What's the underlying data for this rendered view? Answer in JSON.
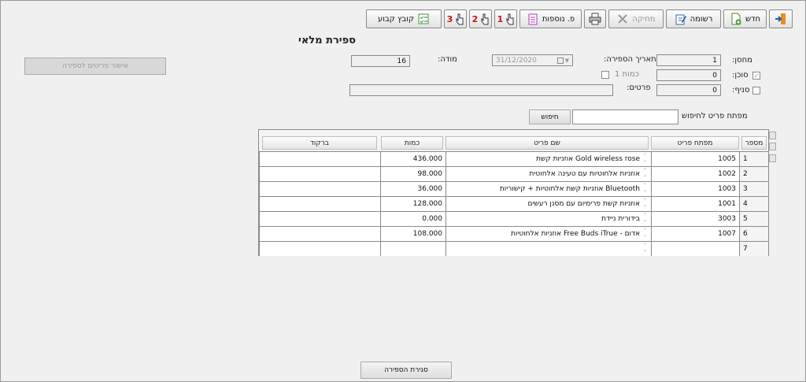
{
  "toolbar": {
    "exit_icon": "exit-door-icon",
    "new_label": "חדש",
    "save_label": "רשומה",
    "delete_label": "מחיקה",
    "more_label": "פ. נוספות",
    "tool1_label": "1",
    "tool2_label": "2",
    "tool3_label": "3",
    "import_label": "קובץ קבוע"
  },
  "page_title": "ספירת מלאי",
  "form": {
    "warehouse_label": "מחסן:",
    "warehouse_value": "1",
    "agent_label": "סוכן:",
    "agent_value": "0",
    "branch_label": "סניף:",
    "branch_value": "0",
    "count_date_label": "תאריך הספירה:",
    "count_date_value": "31/12/2020",
    "quantity1_label": "כמות 1",
    "details_label": "פרטים:",
    "details_value": "",
    "version_label": "מודה:",
    "version_value": "16"
  },
  "confirm_button": "אישור פריטים לספירה",
  "search": {
    "label": "מפתח פריט לחיפוש",
    "value": "",
    "button": "חיפוש"
  },
  "table": {
    "headers": {
      "number": "מספר",
      "item_key": "מפתח פריט",
      "item_name": "שם פריט",
      "quantity": "כמות",
      "barcode": "ברקוד"
    },
    "rows": [
      {
        "number": "1",
        "item_key": "1005",
        "item_name": "אוזניות קשת Gold wireless rose",
        "quantity": "436.000",
        "barcode": ""
      },
      {
        "number": "2",
        "item_key": "1002",
        "item_name": "אוזניות אלחוטיות עם טעינה אלחוטית",
        "quantity": "98.000",
        "barcode": ""
      },
      {
        "number": "3",
        "item_key": "1003",
        "item_name": "אוזניות קשת אלחוטיות + קישוריות Bluetooth",
        "quantity": "36.000",
        "barcode": ""
      },
      {
        "number": "4",
        "item_key": "1001",
        "item_name": "אוזניות קשת פרימיום עם מסנן רעשים",
        "quantity": "128.000",
        "barcode": ""
      },
      {
        "number": "5",
        "item_key": "3003",
        "item_name": "בידורית ניידת",
        "quantity": "0.000",
        "barcode": ""
      },
      {
        "number": "6",
        "item_key": "1007",
        "item_name": "אוזניות אלחוטיות Free Buds iTrue - אדום",
        "quantity": "108.000",
        "barcode": ""
      },
      {
        "number": "7",
        "item_key": "",
        "item_name": "",
        "quantity": "",
        "barcode": ""
      }
    ]
  },
  "close_count_button": "סגירת הספירה"
}
